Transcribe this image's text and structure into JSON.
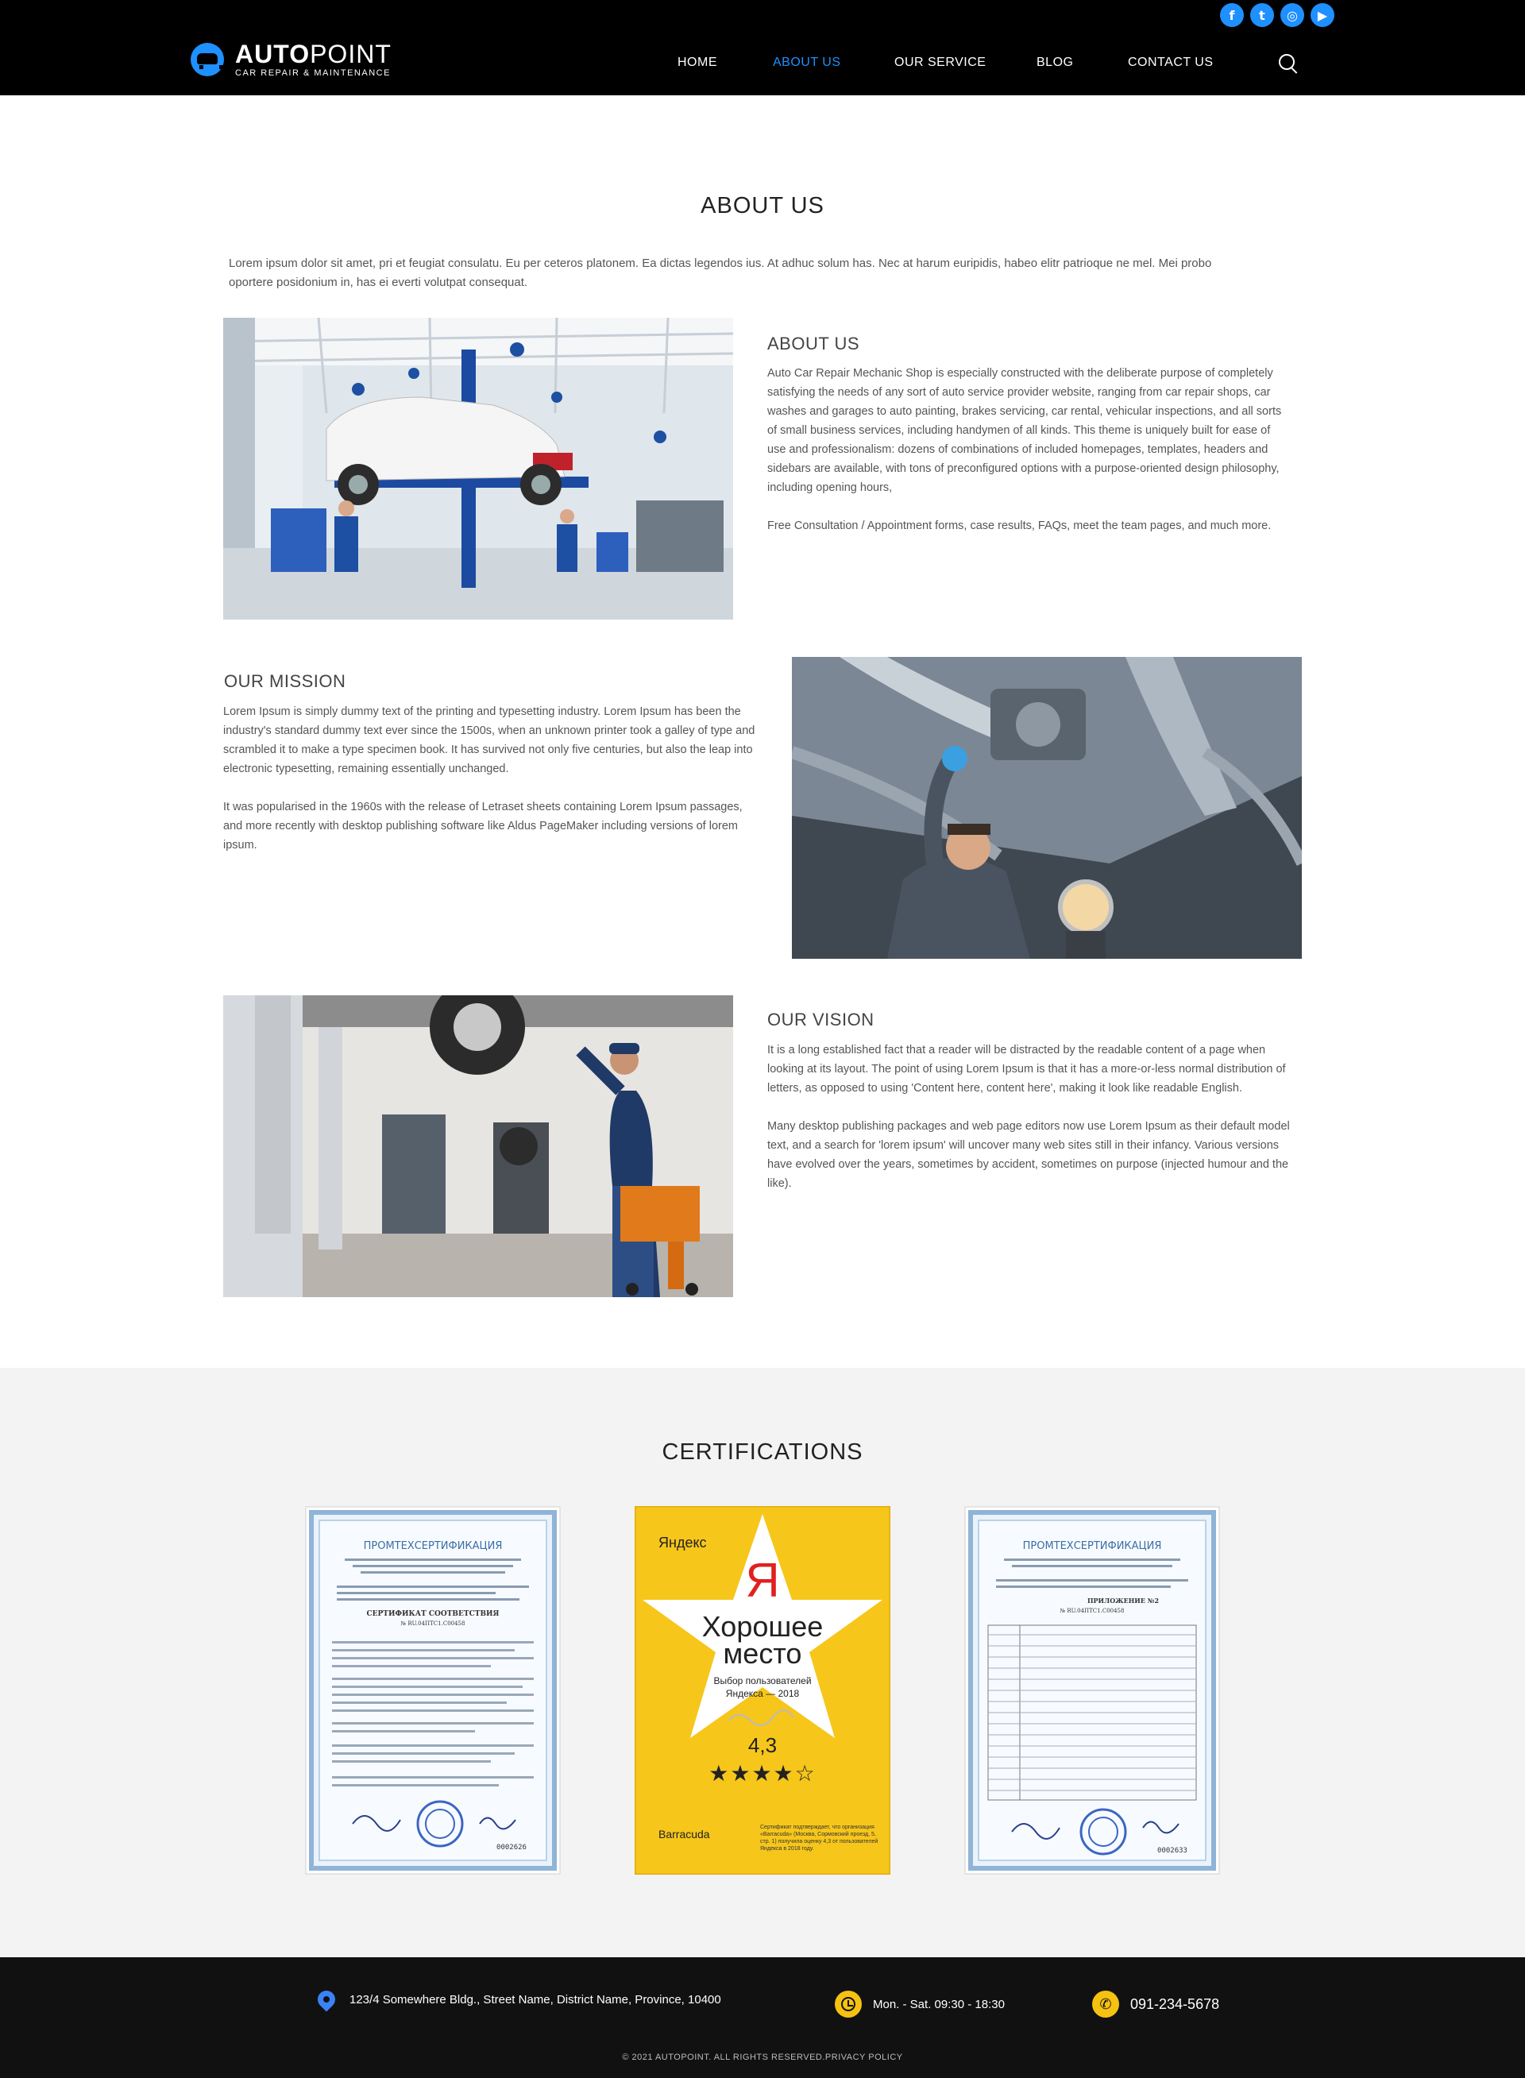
{
  "header": {
    "logo": {
      "name_bold": "AUTO",
      "name_light": "POINT",
      "tagline": "CAR REPAIR & MAINTENANCE"
    },
    "social": [
      {
        "icon": "facebook-icon",
        "glyph": "f"
      },
      {
        "icon": "twitter-icon",
        "glyph": "t"
      },
      {
        "icon": "instagram-icon",
        "glyph": "◎"
      },
      {
        "icon": "youtube-icon",
        "glyph": "▶"
      }
    ],
    "nav": [
      {
        "label": "HOME",
        "active": false
      },
      {
        "label": "ABOUT US",
        "active": true
      },
      {
        "label": "OUR SERVICE",
        "active": false
      },
      {
        "label": "BLOG",
        "active": false
      },
      {
        "label": "CONTACT US",
        "active": false
      }
    ],
    "accent_color": "#1e90ff"
  },
  "about": {
    "title": "ABOUT US",
    "intro": "Lorem ipsum dolor sit amet, pri et feugiat consulatu. Eu per ceteros platonem. Ea dictas legendos ius. At adhuc solum has. Nec at harum euripidis, habeo elitr patrioque ne mel. Mei probo oportere posidonium in, has ei everti volutpat consequat.",
    "sections": [
      {
        "heading": "ABOUT US",
        "paragraphs": [
          "Auto Car Repair Mechanic Shop is especially constructed with the deliberate purpose of completely satisfying the needs of any sort of auto service provider website, ranging from car repair shops, car washes and garages to auto painting, brakes servicing, car rental, vehicular inspections, and all sorts of small business services, including handymen of all kinds. This theme is uniquely built for ease of use and professionalism: dozens of combinations of included homepages, templates, headers and sidebars are available, with tons of preconfigured options with a purpose-oriented design philosophy, including opening hours,",
          "Free Consultation / Appointment forms, case results, FAQs, meet the team pages, and much more."
        ]
      },
      {
        "heading": "OUR MISSION",
        "paragraphs": [
          "Lorem Ipsum is simply dummy text of the printing and typesetting industry. Lorem Ipsum has been the industry's standard dummy text ever since the 1500s, when an unknown printer took a galley of type and scrambled it to make a type specimen book. It has survived not only five centuries, but also the leap into electronic typesetting, remaining essentially unchanged.",
          "It was popularised in the 1960s with the release of Letraset sheets containing Lorem Ipsum passages, and more recently with desktop publishing software like Aldus PageMaker including versions of lorem ipsum."
        ]
      },
      {
        "heading": "OUR VISION",
        "paragraphs": [
          "It is a long established fact that a reader will be distracted by the readable content of a page when looking at its layout. The point of using Lorem Ipsum is that it has a more-or-less normal distribution of letters, as opposed to using 'Content here, content here', making it look like readable English.",
          "Many desktop publishing packages and web page editors now use Lorem Ipsum as their default model text, and a search for 'lorem ipsum' will uncover many web sites still in their infancy. Various versions have evolved over the years, sometimes by accident, sometimes on purpose (injected humour and the like)."
        ]
      }
    ]
  },
  "certifications": {
    "title": "CERTIFICATIONS",
    "cert1": {
      "org": "ПРОМТЕХСЕРТИФИКАЦИЯ",
      "doc_title": "СЕРТИФИКАТ СООТВЕТСТВИЯ",
      "number": "№ RU.04ПТС1.С00458",
      "serial": "0002626"
    },
    "cert2": {
      "brand": "Яндекс",
      "logo_letter": "Я",
      "headline_1": "Хорошее",
      "headline_2": "место",
      "subtitle_1": "Выбор пользователей",
      "subtitle_2": "Яндекса — 2018",
      "rating": "4,3",
      "rating_value": 4.3,
      "business": "Barracuda",
      "note": "Сертификат подтверждает, что организация «Barracuda» (Москва, Сормовский проезд, 5, стр. 1) получила оценку 4,3 от пользователей Яндекса в 2018 году."
    },
    "cert3": {
      "org": "ПРОМТЕХСЕРТИФИКАЦИЯ",
      "doc_title": "ПРИЛОЖЕНИЕ №2",
      "number": "№ RU.04ПТС1.С00458",
      "serial": "0002633"
    }
  },
  "footer": {
    "address": "123/4 Somewhere Bldg., Street Name, District Name, Province, 10400",
    "hours": "Mon. - Sat.  09:30 - 18:30",
    "phone": "091-234-5678",
    "copyright": "©  2021 AUTOPOINT. ALL RIGHTS RESERVED.PRIVACY POLICY"
  }
}
